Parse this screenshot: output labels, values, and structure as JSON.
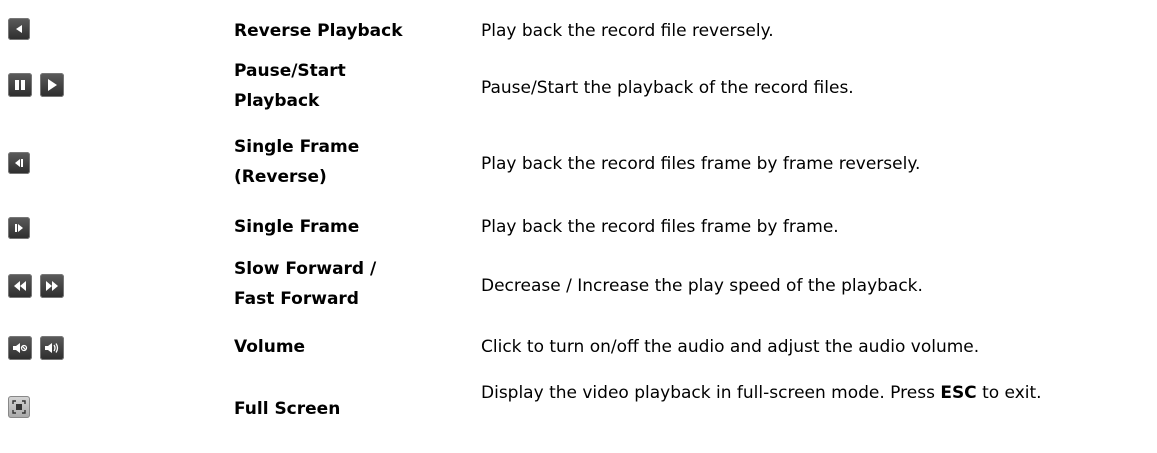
{
  "rows": [
    {
      "icons": [
        "reverse-play-icon"
      ],
      "name_lines": [
        "Reverse Playback"
      ],
      "description": "Play back the record file reversely."
    },
    {
      "icons": [
        "pause-icon",
        "play-icon"
      ],
      "name_lines": [
        "Pause/Start",
        "Playback"
      ],
      "description": "Pause/Start the playback of the record files."
    },
    {
      "icons": [
        "single-frame-reverse-icon"
      ],
      "name_lines": [
        "Single Frame",
        "(Reverse)"
      ],
      "description": "Play back the record files frame by frame reversely."
    },
    {
      "icons": [
        "single-frame-forward-icon"
      ],
      "name_lines": [
        "Single Frame"
      ],
      "description": "Play back the record files frame by frame."
    },
    {
      "icons": [
        "slow-forward-icon",
        "fast-forward-icon"
      ],
      "name_lines": [
        "Slow Forward /",
        "Fast Forward"
      ],
      "description": "Decrease / Increase the play speed of the playback."
    },
    {
      "icons": [
        "audio-off-icon",
        "audio-on-icon"
      ],
      "name_lines": [
        "Volume"
      ],
      "description": "Click to turn on/off the audio and adjust the audio volume."
    },
    {
      "icons": [
        "full-screen-icon"
      ],
      "name_lines": [
        "Full Screen"
      ],
      "description_parts": [
        "Display the video playback in full-screen mode. Press ",
        "ESC",
        " to exit."
      ]
    }
  ]
}
